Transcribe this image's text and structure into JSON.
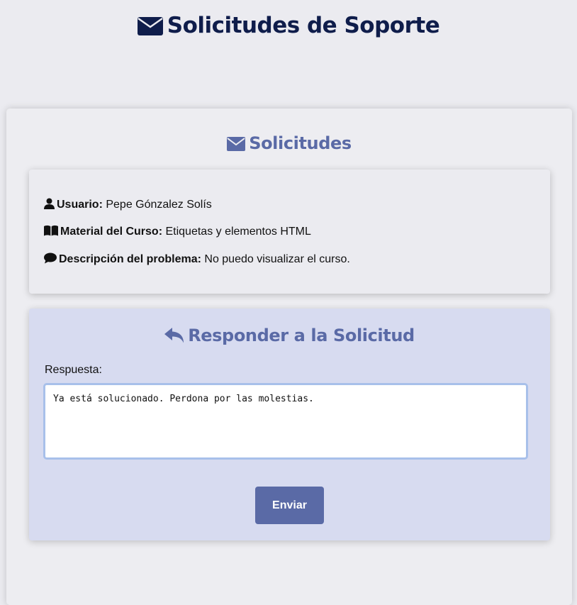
{
  "header": {
    "icon": "envelope-icon",
    "title": "Solicitudes de Soporte"
  },
  "card": {
    "icon": "envelope-icon",
    "title": "Solicitudes"
  },
  "request": {
    "user": {
      "icon": "user-icon",
      "label": "Usuario:",
      "value": " Pepe Gónzalez Solís"
    },
    "course_material": {
      "icon": "book-open-icon",
      "label": "Material del Curso:",
      "value": " Etiquetas y elementos HTML"
    },
    "problem_description": {
      "icon": "comment-icon",
      "label": "Descripción del problema:",
      "value": " No puedo visualizar el curso."
    }
  },
  "reply": {
    "icon": "reply-icon",
    "title": "Responder a la Solicitud",
    "field_label": "Respuesta:",
    "response_value": "Ya está solucionado. Perdona por las molestias.",
    "submit_label": "Enviar"
  },
  "colors": {
    "page_background": "#ebebf0",
    "header_text": "#0f1d4b",
    "accent": "#5a6aa6",
    "reply_background": "#d7dbf0",
    "textarea_focus_border": "#a8c0ea"
  }
}
